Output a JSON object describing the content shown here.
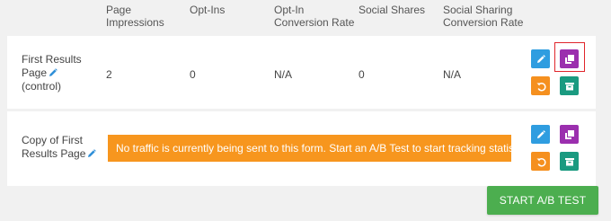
{
  "columns": [
    {
      "label_line1": "Page",
      "label_line2": "Impressions"
    },
    {
      "label_line1": "Opt-Ins",
      "label_line2": ""
    },
    {
      "label_line1": "Opt-In",
      "label_line2": "Conversion Rate"
    },
    {
      "label_line1": "Social Shares",
      "label_line2": ""
    },
    {
      "label_line1": "Social Sharing",
      "label_line2": "Conversion Rate"
    }
  ],
  "rows": [
    {
      "name_line1": "First Results",
      "name_line2": "Page",
      "name_line3": "(control)",
      "page_impressions": "2",
      "opt_ins": "0",
      "opt_in_conversion_rate": "N/A",
      "social_shares": "0",
      "social_sharing_conversion_rate": "N/A"
    },
    {
      "name_line1": "Copy of First",
      "name_line2": "Results Page",
      "notice": "No traffic is currently being sent to this form. Start an A/B Test to start tracking statistics"
    }
  ],
  "actions": {
    "edit_icon": "pencil-icon",
    "duplicate_icon": "duplicate-icon",
    "revert_icon": "undo-icon",
    "archive_icon": "archive-icon"
  },
  "start_button_label": "START A/B TEST",
  "colors": {
    "edit": "#2f9de0",
    "duplicate": "#9b2fae",
    "revert": "#f5901f",
    "archive": "#1a9a80",
    "notice": "#f7961e",
    "start": "#4cae4f",
    "highlight": "#e0252b"
  }
}
